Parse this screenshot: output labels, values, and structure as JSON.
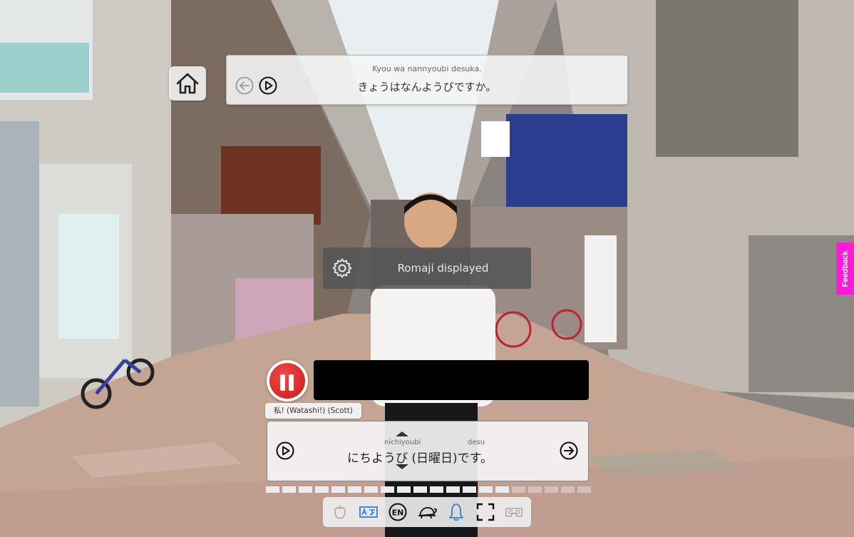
{
  "prompt": {
    "romaji": "Kyou wa nannyoubi desuka.",
    "japanese": "きょうはなんようびですか。"
  },
  "settings": {
    "status_text": "Romaji displayed"
  },
  "speaker": {
    "label": "私! (Watashi!) (Scott)"
  },
  "answer": {
    "ruby_1": "nichiyoubi",
    "ruby_2": "desu",
    "japanese": "にちようび (日曜日)です。"
  },
  "progress": {
    "segments_total": 20,
    "segments_completed": 15
  },
  "toolbar": {
    "tools": [
      "apple-icon",
      "translate-icon",
      "en-language-icon",
      "turtle-slow-icon",
      "bell-icon",
      "fullscreen-icon",
      "vr-headset-icon"
    ]
  },
  "feedback": {
    "label": "Feedback"
  },
  "colors": {
    "pause_red": "#d82525",
    "feedback_magenta": "#ff1ad9",
    "bell_blue": "#2f7fd8"
  }
}
